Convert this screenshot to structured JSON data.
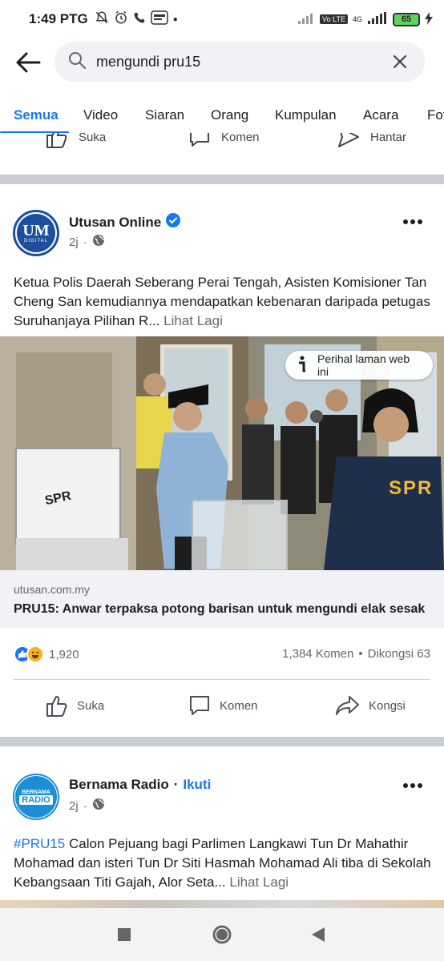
{
  "status_bar": {
    "time": "1:49 PTG",
    "network": "4G",
    "volte": "Vo LTE",
    "battery": "65"
  },
  "search": {
    "query": "mengundi pru15"
  },
  "tabs": [
    "Semua",
    "Video",
    "Siaran",
    "Orang",
    "Kumpulan",
    "Acara",
    "Fot"
  ],
  "previous_post_actions": {
    "like": "Suka",
    "comment": "Komen",
    "send": "Hantar"
  },
  "post1": {
    "page_name": "Utusan Online",
    "verified": true,
    "avatar_text": "UM",
    "avatar_subtext": "DIGITAL",
    "time": "2j",
    "text": "Ketua Polis Daerah Seberang Perai Tengah, Asisten Komisioner Tan Cheng San kemudiannya mendapatkan kebenaran daripada petugas Suruhanjaya Pilihan R...",
    "see_more": "Lihat Lagi",
    "about_site": "Perihal laman web ini",
    "photo_box_label": "SPR",
    "photo_vest_label": "SPR",
    "link_domain": "utusan.com.my",
    "link_title": "PRU15: Anwar terpaksa potong barisan untuk mengundi elak sesak",
    "reactions_count": "1,920",
    "comments": "1,384 Komen",
    "shares": "Dikongsi 63",
    "actions": {
      "like": "Suka",
      "comment": "Komen",
      "share": "Kongsi"
    }
  },
  "post2": {
    "page_name": "Bernama Radio",
    "follow": "Ikuti",
    "avatar_line1": "BERNAMA",
    "avatar_line2": "RADIO",
    "time": "2j",
    "hashtag": "#PRU15",
    "text": " Calon Pejuang bagi Parlimen Langkawi Tun Dr Mahathir Mohamad dan isteri Tun Dr Siti Hasmah Mohamad Ali tiba di Sekolah Kebangsaan Titi Gajah, Alor Seta...",
    "see_more": "Lihat Lagi"
  },
  "colors": {
    "accent": "#1877f2",
    "divider": "#c9ccd1",
    "secondary_text": "#65676b"
  }
}
